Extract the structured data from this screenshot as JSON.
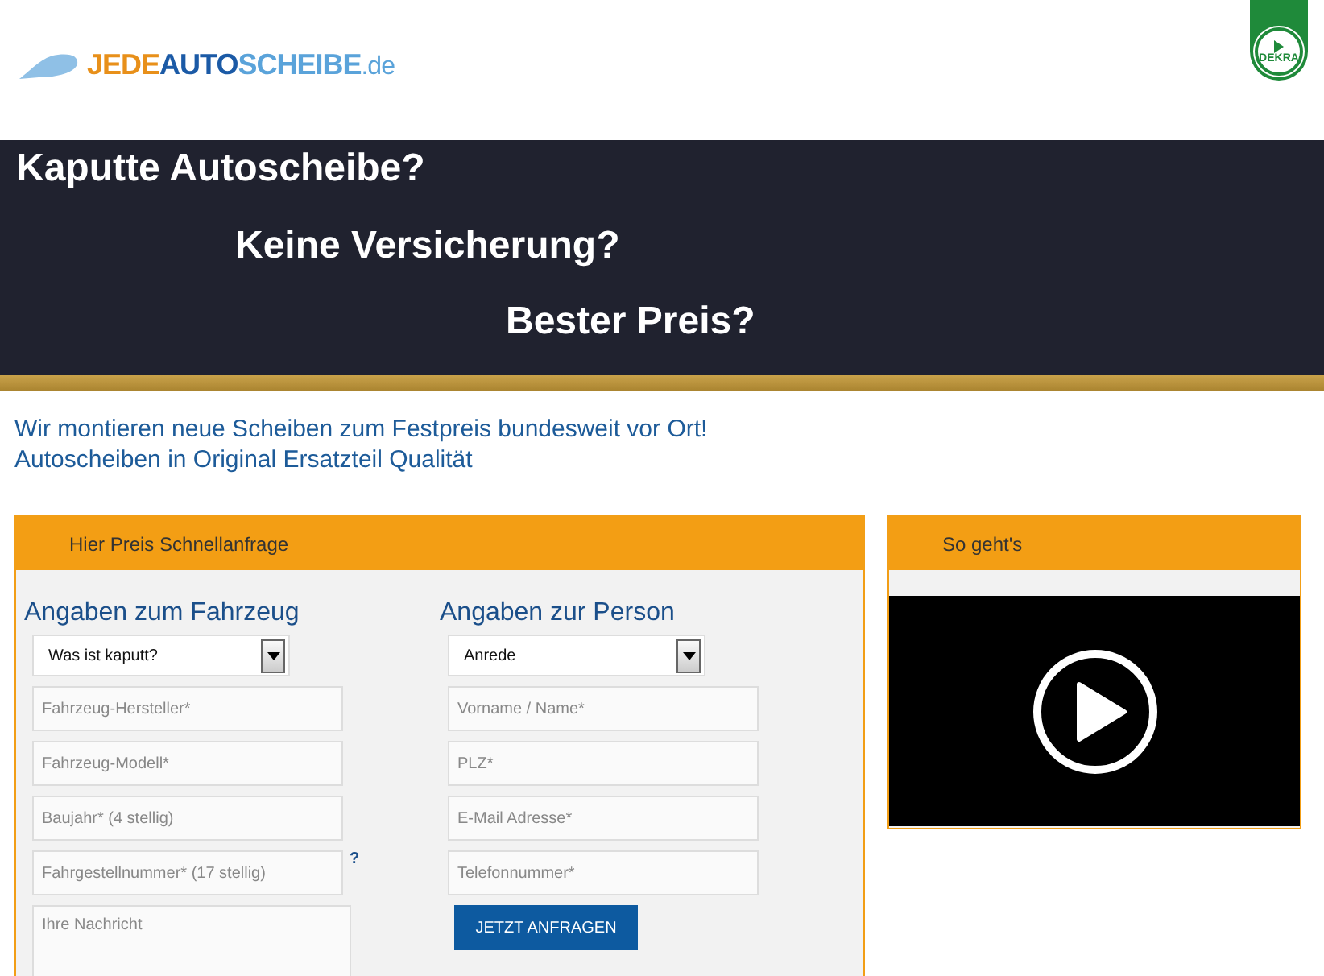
{
  "logo": {
    "parts": [
      {
        "text": "JEDE",
        "kind": "accent"
      },
      {
        "text": "AUTO",
        "kind": "strong"
      },
      {
        "text": "SCHEIBE",
        "kind": "light"
      },
      {
        "text": ".de",
        "kind": "suffix"
      }
    ]
  },
  "badge": {
    "text": "DEKRA"
  },
  "banner": {
    "lines": [
      "Kaputte Autoscheibe?",
      "Keine Versicherung?",
      "Bester Preis?"
    ]
  },
  "intro": [
    "Wir montieren neue Scheiben zum Festpreis bundesweit vor Ort!",
    "Autoscheiben in Original Ersatzteil Qualität"
  ],
  "form": {
    "title": "Hier Preis Schnellanfrage",
    "columns": [
      {
        "heading": "Angaben zum Fahrzeug",
        "fields": [
          {
            "kind": "select",
            "value": "Was ist kaputt?"
          },
          {
            "kind": "input",
            "placeholder": "Fahrzeug-Hersteller*"
          },
          {
            "kind": "input",
            "placeholder": "Fahrzeug-Modell*"
          },
          {
            "kind": "input",
            "placeholder": "Baujahr* (4 stellig)"
          },
          {
            "kind": "input",
            "placeholder": "Fahrgestellnummer* (17 stellig)",
            "help": "?"
          },
          {
            "kind": "textarea",
            "placeholder": "Ihre Nachricht"
          }
        ]
      },
      {
        "heading": "Angaben zur Person",
        "fields": [
          {
            "kind": "select",
            "value": "Anrede"
          },
          {
            "kind": "input",
            "placeholder": "Vorname / Name*"
          },
          {
            "kind": "input",
            "placeholder": "PLZ*"
          },
          {
            "kind": "input",
            "placeholder": "E-Mail Adresse*"
          },
          {
            "kind": "input",
            "placeholder": "Telefonnummer*"
          },
          {
            "kind": "button",
            "label": "JETZT ANFRAGEN"
          }
        ]
      }
    ]
  },
  "video_panel": {
    "title": "So geht's"
  }
}
